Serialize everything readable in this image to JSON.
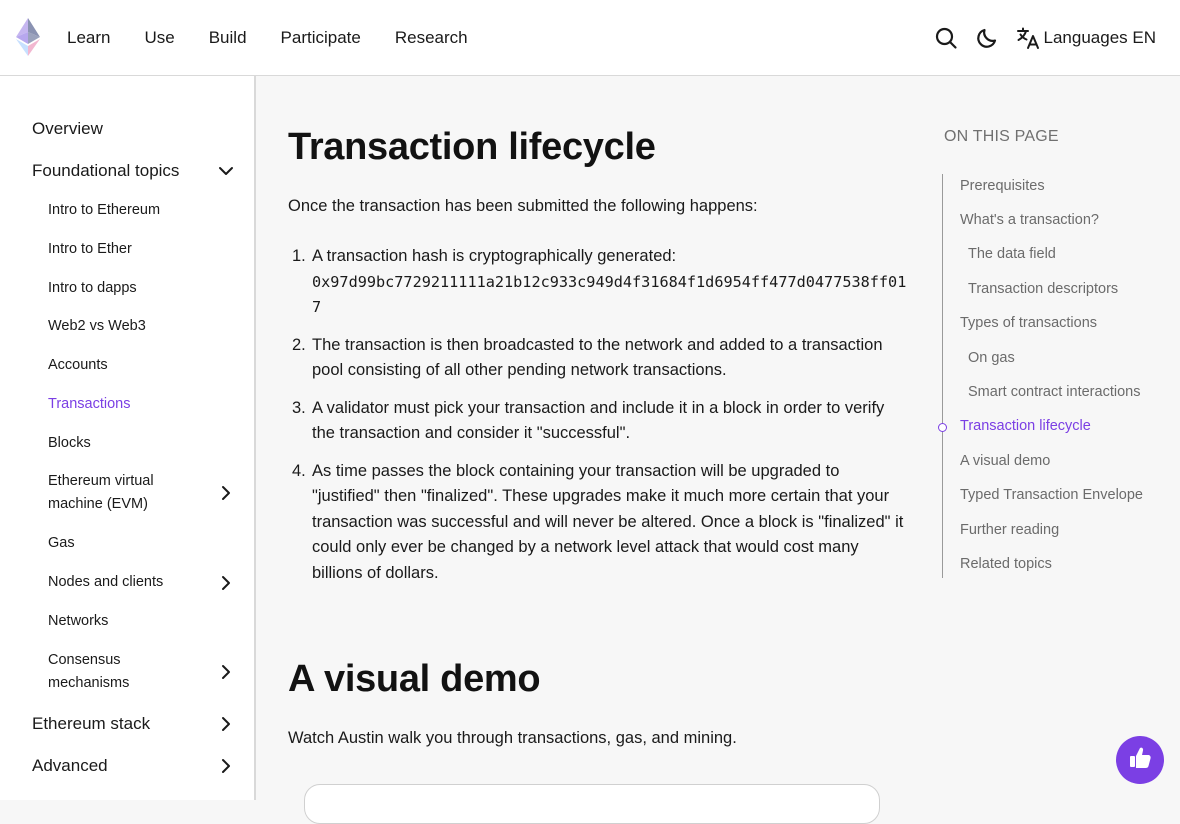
{
  "header": {
    "nav": [
      "Learn",
      "Use",
      "Build",
      "Participate",
      "Research"
    ],
    "language_label": "Languages EN"
  },
  "sidebar": {
    "items": [
      {
        "label": "Overview",
        "level": "top",
        "chevron": "none"
      },
      {
        "label": "Foundational topics",
        "level": "top",
        "chevron": "down"
      },
      {
        "label": "Intro to Ethereum",
        "level": "sub",
        "chevron": "none"
      },
      {
        "label": "Intro to Ether",
        "level": "sub",
        "chevron": "none"
      },
      {
        "label": "Intro to dapps",
        "level": "sub",
        "chevron": "none"
      },
      {
        "label": "Web2 vs Web3",
        "level": "sub",
        "chevron": "none"
      },
      {
        "label": "Accounts",
        "level": "sub",
        "chevron": "none"
      },
      {
        "label": "Transactions",
        "level": "sub",
        "chevron": "none",
        "active": true
      },
      {
        "label": "Blocks",
        "level": "sub",
        "chevron": "none"
      },
      {
        "label": "Ethereum virtual machine (EVM)",
        "level": "sub",
        "chevron": "right"
      },
      {
        "label": "Gas",
        "level": "sub",
        "chevron": "none"
      },
      {
        "label": "Nodes and clients",
        "level": "sub",
        "chevron": "right"
      },
      {
        "label": "Networks",
        "level": "sub",
        "chevron": "none"
      },
      {
        "label": "Consensus mechanisms",
        "level": "sub",
        "chevron": "right"
      },
      {
        "label": "Ethereum stack",
        "level": "top",
        "chevron": "right"
      },
      {
        "label": "Advanced",
        "level": "top",
        "chevron": "right"
      }
    ]
  },
  "main": {
    "lifecycle_title": "Transaction lifecycle",
    "lifecycle_intro": "Once the transaction has been submitted the following happens:",
    "steps": [
      {
        "number": "1.",
        "text": "A transaction hash is cryptographically generated:",
        "code": "0x97d99bc7729211111a21b12c933c949d4f31684f1d6954ff477d0477538ff017"
      },
      {
        "number": "2.",
        "text": "The transaction is then broadcasted to the network and added to a transaction pool consisting of all other pending network transactions."
      },
      {
        "number": "3.",
        "text": "A validator must pick your transaction and include it in a block in order to verify the transaction and consider it \"successful\"."
      },
      {
        "number": "4.",
        "text": "As time passes the block containing your transaction will be upgraded to \"justified\" then \"finalized\". These upgrades make it much more certain that your transaction was successful and will never be altered. Once a block is \"finalized\" it could only ever be changed by a network level attack that would cost many billions of dollars."
      }
    ],
    "demo_title": "A visual demo",
    "demo_intro": "Watch Austin walk you through transactions, gas, and mining."
  },
  "toc": {
    "title": "ON THIS PAGE",
    "items": [
      {
        "label": "Prerequisites",
        "indent": false
      },
      {
        "label": "What's a transaction?",
        "indent": false
      },
      {
        "label": "The data field",
        "indent": true
      },
      {
        "label": "Transaction descriptors",
        "indent": true
      },
      {
        "label": "Types of transactions",
        "indent": false
      },
      {
        "label": "On gas",
        "indent": true
      },
      {
        "label": "Smart contract interactions",
        "indent": true
      },
      {
        "label": "Transaction lifecycle",
        "indent": false,
        "active": true
      },
      {
        "label": "A visual demo",
        "indent": false
      },
      {
        "label": "Typed Transaction Envelope",
        "indent": false
      },
      {
        "label": "Further reading",
        "indent": false
      },
      {
        "label": "Related topics",
        "indent": false
      }
    ]
  },
  "colors": {
    "accent": "#7b3fe4",
    "text": "#1a1a1a",
    "muted": "#6b6b6b"
  },
  "icons": {
    "logo": "ethereum-logo",
    "search": "search-icon",
    "theme": "moon-icon",
    "language": "translate-icon",
    "feedback": "feedback-hand-icon"
  }
}
